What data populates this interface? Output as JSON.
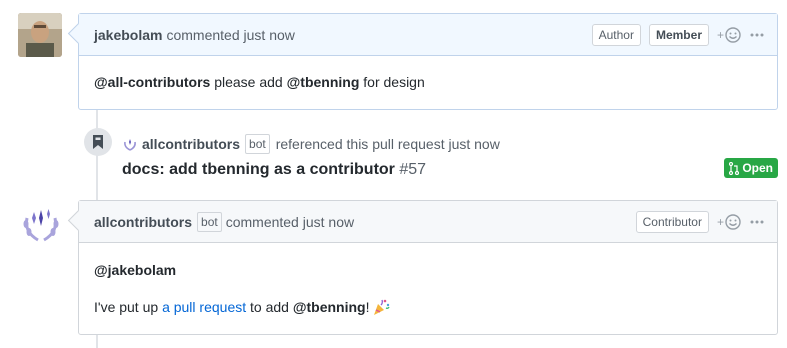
{
  "comment1": {
    "author": "jakebolam",
    "meta": "commented just now",
    "labels": [
      "Author",
      "Member"
    ],
    "body_mention1": "@all-contributors",
    "body_text": " please add ",
    "body_mention2": "@tbenning",
    "body_text2": " for design"
  },
  "reference": {
    "author": "allcontributors",
    "bot_label": "bot",
    "meta": "referenced this pull request just now",
    "title": "docs: add tbenning as a contributor",
    "number": "#57",
    "state": "Open"
  },
  "comment2": {
    "author": "allcontributors",
    "bot_label": "bot",
    "meta": "commented just now",
    "label": "Contributor",
    "mention": "@jakebolam",
    "line_pre": "I've put up ",
    "line_link": "a pull request",
    "line_mid": " to add ",
    "line_mention": "@tbenning",
    "line_end": "!"
  },
  "icons": {
    "reaction": "smiley-icon",
    "more": "kebab-horizontal-icon",
    "bookmark": "bookmark-icon",
    "pr": "git-pull-request-icon"
  },
  "colors": {
    "accent": "#0366d6",
    "open": "#28a745"
  }
}
